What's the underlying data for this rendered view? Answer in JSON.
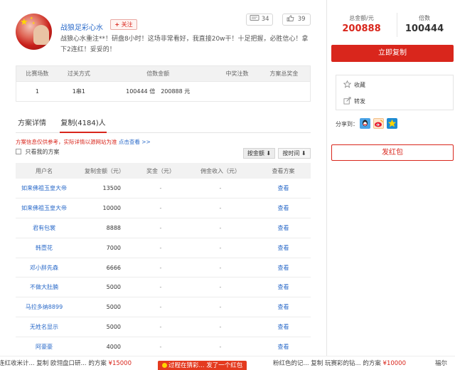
{
  "plan": {
    "author": "战狼足彩心水",
    "follow_label": "关注",
    "comment_count": "34",
    "like_count": "39",
    "description": "战狼心水重注**！研盘8小时！这场非常看好，我直接20w干！十足把握，必胜信心！拿下2连红！妥妥的！"
  },
  "summary": {
    "headers": [
      "比赛场数",
      "过关方式",
      "倍数金额",
      "中奖注数",
      "方案总奖金"
    ],
    "row": {
      "matches": "1",
      "pass_type": "1串1",
      "multiple_amount": "100444 倍　200888 元",
      "winning_bets": "",
      "total_prize": ""
    }
  },
  "tabs": {
    "detail": "方案详情",
    "copy": "复制(4184)人"
  },
  "notice": {
    "text": "方案信息仅供参考，实际详情以源网站为准",
    "link": "点击查看 >>"
  },
  "filters": {
    "only_mine": "只看我的方案",
    "sort_amount": "按金额 ⬇",
    "sort_time": "按时间 ⬇"
  },
  "copy_table": {
    "headers": [
      "用户名",
      "复制金额（元）",
      "奖金（元）",
      "佣金收入（元）",
      "查看方案"
    ],
    "rows": [
      {
        "user": "如来佛祖玉皇大帝",
        "amount": "13500",
        "bonus": "-",
        "commission": "-",
        "action": "查看"
      },
      {
        "user": "如来佛祖玉皇大帝",
        "amount": "10000",
        "bonus": "-",
        "commission": "-",
        "action": "查看"
      },
      {
        "user": "君有包裳",
        "amount": "8888",
        "bonus": "-",
        "commission": "-",
        "action": "查看"
      },
      {
        "user": "韩壹花",
        "amount": "7000",
        "bonus": "-",
        "commission": "-",
        "action": "查看"
      },
      {
        "user": "邓小胖先森",
        "amount": "6666",
        "bonus": "-",
        "commission": "-",
        "action": "查看"
      },
      {
        "user": "不做大肚腩",
        "amount": "5000",
        "bonus": "-",
        "commission": "-",
        "action": "查看"
      },
      {
        "user": "马拉多纳8899",
        "amount": "5000",
        "bonus": "-",
        "commission": "-",
        "action": "查看"
      },
      {
        "user": "无姓名显示",
        "amount": "5000",
        "bonus": "-",
        "commission": "-",
        "action": "查看"
      },
      {
        "user": "阿豪豪",
        "amount": "4000",
        "bonus": "-",
        "commission": "-",
        "action": "查看"
      }
    ]
  },
  "sidebar": {
    "total_label": "总金额/元",
    "total_value": "200888",
    "multiple_label": "倍数",
    "multiple_value": "100444",
    "copy_now": "立即复制",
    "favorite": "收藏",
    "forward": "转发",
    "share_label": "分享到：",
    "red_packet": "发红包"
  },
  "ticker": {
    "left_text": "连红收米计...  复制 欧翎盘口研... 的方案 ",
    "left_money": "¥15000",
    "mid_text": "过程在猜彩... 发了一个红包",
    "right_text": "粉红色的记...  复制 玩赛彩的钻... 的方案 ",
    "right_money": "¥10000",
    "far_right_text": "福尔"
  },
  "colors": {
    "accent": "#d9261c",
    "link": "#2a6ac9"
  }
}
